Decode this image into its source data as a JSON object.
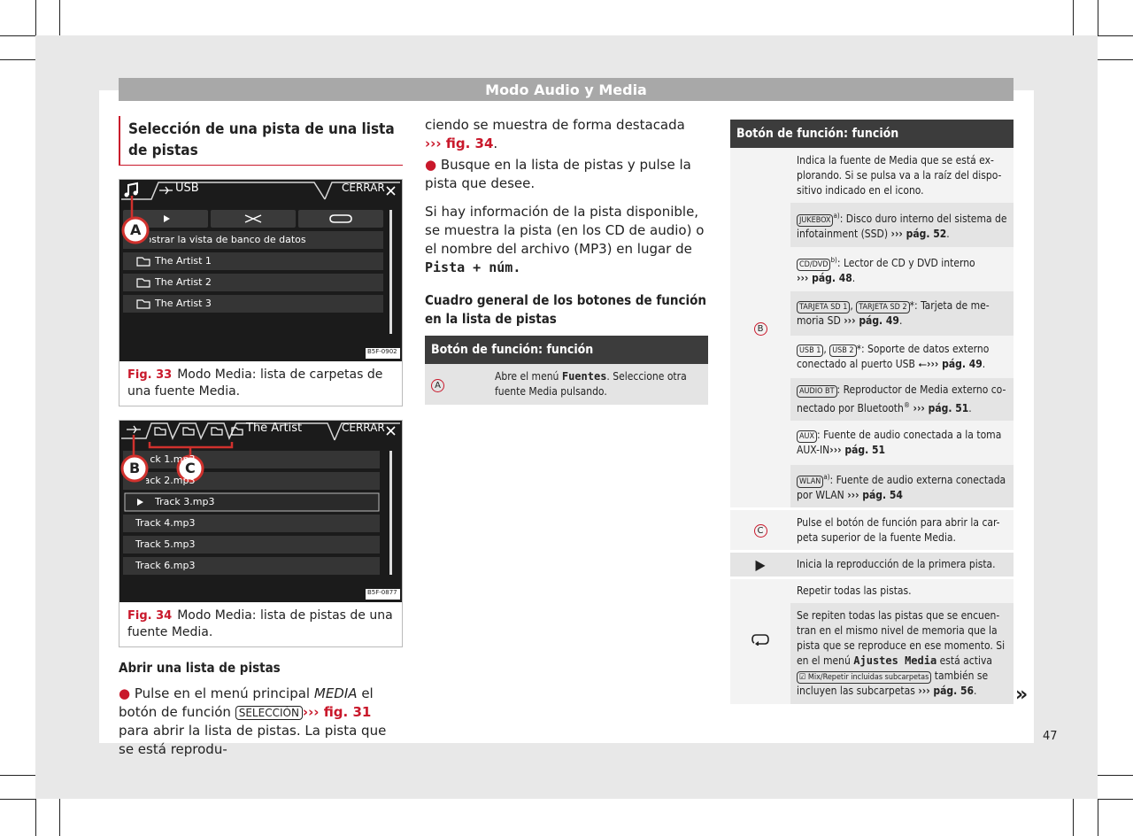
{
  "header": {
    "title": "Modo Audio y Media"
  },
  "column1": {
    "section_title": "Selección de una pista de una lista de pistas",
    "fig33": {
      "screen": {
        "source": "USB",
        "close": "CERRAR",
        "callout": "A",
        "menu_item": "Mostrar la vista de banco de datos",
        "items": [
          "The Artist 1",
          "The Artist 2",
          "The Artist 3"
        ],
        "code": "B5F-0902"
      },
      "number": "Fig. 33",
      "caption": "Modo Media: lista de carpetas de una fuente Media."
    },
    "fig34": {
      "screen": {
        "folder": "The Artist",
        "close": "CERRAR",
        "callout_b": "B",
        "callout_c": "C",
        "tracks": [
          "Track 1.mp3",
          "Track 2.mp3",
          "Track 3.mp3",
          "Track 4.mp3",
          "Track 5.mp3",
          "Track 6.mp3"
        ],
        "code": "B5F-0877"
      },
      "number": "Fig. 34",
      "caption": "Modo Media: lista de pistas de una fuente Media."
    },
    "open_title": "Abrir una lista de pistas",
    "open_p1": "Pulse en el menú principal",
    "open_p_media": "MEDIA",
    "open_p2": "el botón de función",
    "open_key": "SELECCIÓN",
    "open_ref": "››› fig. 31",
    "open_p3": "para abrir la lista de pistas. La pista que se está reprodu-"
  },
  "column2": {
    "p1": "ciendo se muestra de forma destacada",
    "p1_ref": "››› fig. 34",
    "p1_end": ".",
    "p2": "Busque en la lista de pistas y pulse la pista que desee.",
    "p3": "Si hay información de la pista disponible, se muestra la pista (en los CD de audio) o el nombre del archivo (MP3) en lugar de",
    "p3_mono": "Pista + núm.",
    "subtitle": "Cuadro general de los botones de función en la lista de pistas",
    "table_header": "Botón de función: función",
    "row_a_letter": "A",
    "row_a_text1": "Abre el menú",
    "row_a_mono": "Fuentes",
    "row_a_text2": ". Seleccione otra fuente Media pulsando."
  },
  "column3": {
    "table_header": "Botón de función: función",
    "b_letter": "B",
    "b_rows": {
      "intro": "Indica la fuente de Media que se está ex-plorando. Si se pulsa va a la raíz del dispo-sitivo indicado en el icono.",
      "jukebox_key": "JUKEBOX",
      "jukebox_sup": "a)",
      "jukebox_text": ": Disco duro interno del sistema de infotainment (SSD)",
      "jukebox_ref": "››› pág. 52",
      "cd_key": "CD/DVD",
      "cd_sup": "b)",
      "cd_text": ": Lector de CD y DVD interno",
      "cd_ref": "››› pág. 48",
      "sd1_key": "TARJETA SD 1",
      "sd2_key": "TARJETA SD 2",
      "sd_text": "*: Tarjeta de me-moria SD",
      "sd_ref": "››› pág. 49",
      "usb1_key": "USB 1",
      "usb2_key": "USB 2",
      "usb_text": "*: Soporte de datos externo conectado al puerto USB",
      "usb_ref": "››› pág. 49",
      "bt_key": "AUDIO BT",
      "bt_text": ": Reproductor de Media externo co-nectado por Bluetooth",
      "bt_reg": "®",
      "bt_ref": "››› pág. 51",
      "aux_key": "AUX",
      "aux_text": ": Fuente de audio conectada a la toma AUX-IN",
      "aux_ref": "››› pág. 51",
      "wlan_key": "WLAN",
      "wlan_sup": "a)",
      "wlan_text": ": Fuente de audio externa conectada por WLAN",
      "wlan_ref": "››› pág. 54"
    },
    "c_letter": "C",
    "c_text": "Pulse el botón de función para abrir la car-peta superior de la fuente Media.",
    "play_text": "Inicia la reproducción de la primera pista.",
    "repeat_text1": "Repetir todas las pistas.",
    "repeat_text2a": "Se repiten todas las pistas que se encuen-tran en el mismo nivel de memoria que la pista que se reproduce en ese momento. Si en el menú",
    "repeat_mono": "Ajustes Media",
    "repeat_text2b": "está activa",
    "repeat_key": "Mix/Repetir incluidas subcarpetas",
    "repeat_text2c": "también se incluyen las subcarpetas",
    "repeat_ref": "››› pág. 56",
    "repeat_end": "."
  },
  "continuation": "»",
  "page_number": "47"
}
